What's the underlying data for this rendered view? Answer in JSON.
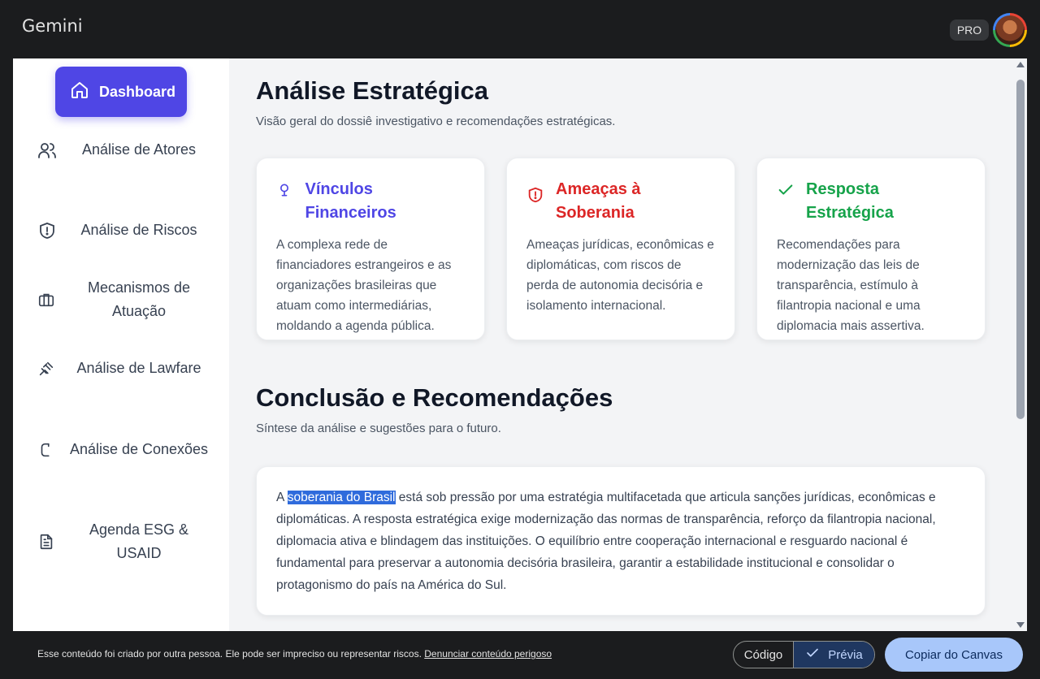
{
  "app": {
    "title": "Gemini",
    "pro_badge": "PRO"
  },
  "sidebar": {
    "active": {
      "label": "Dashboard",
      "icon": "home-icon"
    },
    "items": [
      {
        "label": "Análise de Atores",
        "icon": "users-icon"
      },
      {
        "label": "Análise de Riscos",
        "icon": "shield-alert-icon"
      },
      {
        "label": "Mecanismos de Atuação",
        "icon": "briefcase-icon"
      },
      {
        "label": "Análise de Lawfare",
        "icon": "gavel-icon"
      },
      {
        "label": "Análise de Conexões",
        "icon": "link-icon"
      },
      {
        "label": "Agenda ESG & USAID",
        "icon": "document-icon"
      }
    ]
  },
  "main": {
    "title": "Análise Estratégica",
    "subtitle": "Visão geral do dossiê investigativo e recomendações estratégicas.",
    "cards": [
      {
        "title": "Vínculos Financeiros",
        "color": "#4f46e5",
        "icon": "lightbulb-icon",
        "text": "A complexa rede de financiadores estrangeiros e as organizações brasileiras que atuam como intermediárias, moldando a agenda pública."
      },
      {
        "title": "Ameaças à Soberania",
        "color": "#dc2626",
        "icon": "shield-alert-icon",
        "text": "Ameaças jurídicas, econômicas e diplomáticas, com riscos de perda de autonomia decisória e isolamento internacional."
      },
      {
        "title": "Resposta Estratégica",
        "color": "#16a34a",
        "icon": "check-icon",
        "text": "Recomendações para modernização das leis de transparência, estímulo à filantropia nacional e uma diplomacia mais assertiva."
      }
    ],
    "conclusion": {
      "title": "Conclusão e Recomendações",
      "subtitle": "Síntese da análise e sugestões para o futuro.",
      "text_prefix": "A ",
      "highlighted": "soberania do Brasil",
      "text_rest": " está sob pressão por uma estratégia multifacetada que articula sanções jurídicas, econômicas e diplomáticas. A resposta estratégica exige modernização das normas de transparência, reforço da filantropia nacional, diplomacia ativa e blindagem das instituições. O equilíbrio entre cooperação internacional e resguardo nacional é fundamental para preservar a autonomia decisória brasileira, garantir a estabilidade institucional e consolidar o protagonismo do país na América do Sul."
    }
  },
  "footer": {
    "disclaimer": "Esse conteúdo foi criado por outra pessoa. Ele pode ser impreciso ou representar riscos.",
    "report_link": "Denunciar conteúdo perigoso",
    "code_label": "Código",
    "preview_label": "Prévia",
    "copy_label": "Copiar do Canvas"
  }
}
